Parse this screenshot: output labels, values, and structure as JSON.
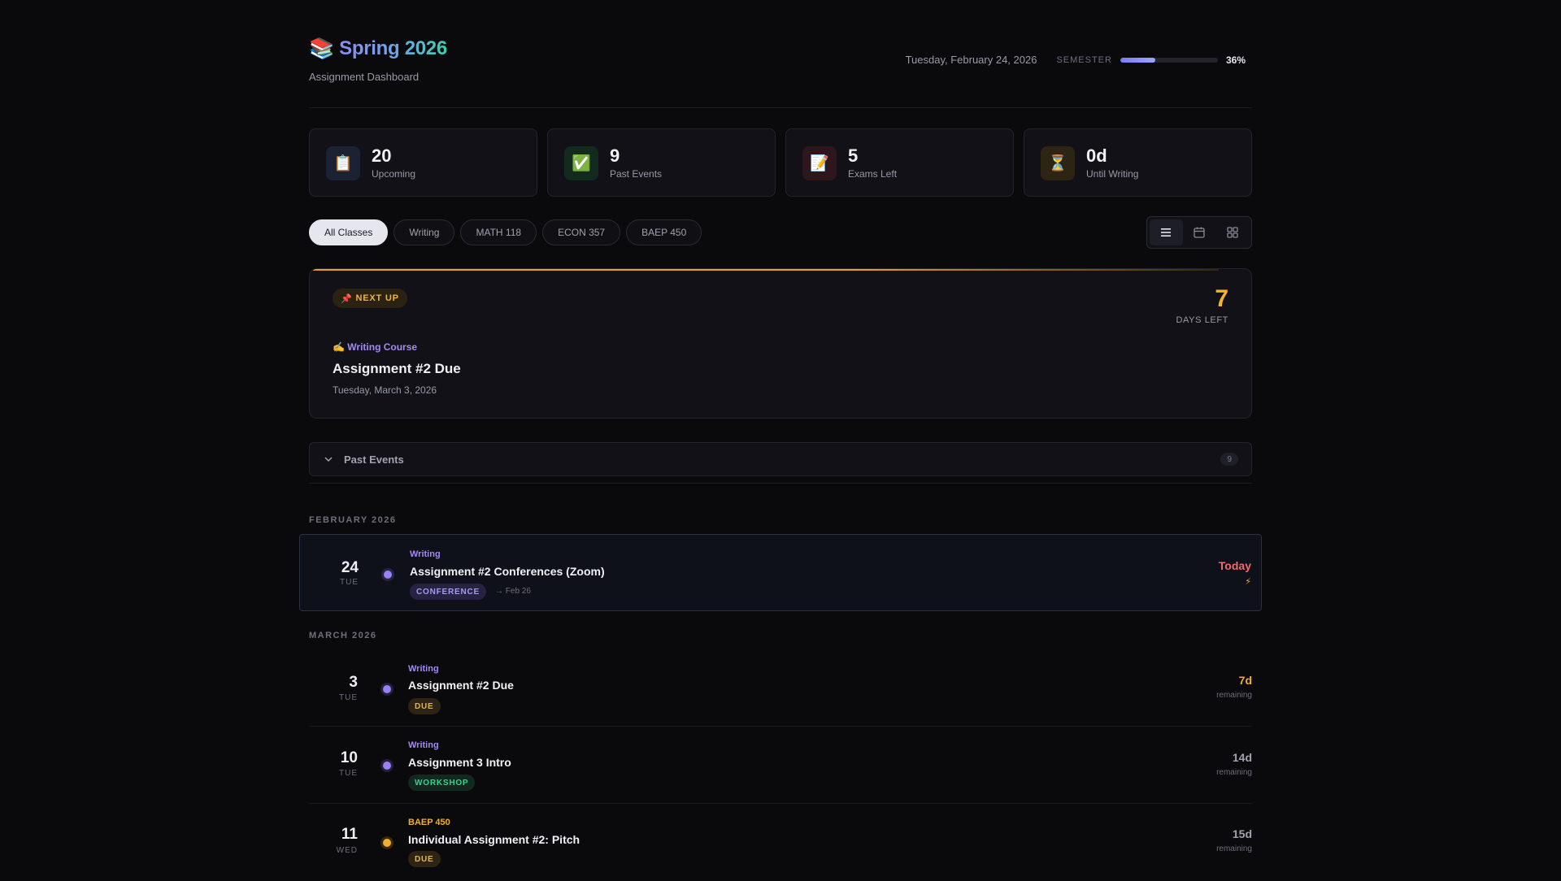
{
  "header": {
    "emoji": "📚",
    "title": "Spring 2026",
    "subtitle": "Assignment Dashboard",
    "today": "Tuesday, February 24, 2026",
    "semester_label": "SEMESTER",
    "semester_progress": 0.36,
    "semester_pct_text": "36%"
  },
  "stats": [
    {
      "icon": "📋",
      "value": "20",
      "label": "Upcoming"
    },
    {
      "icon": "✅",
      "value": "9",
      "label": "Past Events"
    },
    {
      "icon": "📝",
      "value": "5",
      "label": "Exams Left"
    },
    {
      "icon": "⏳",
      "value": "0d",
      "label": "Until Writing"
    }
  ],
  "filters": [
    "All Classes",
    "Writing",
    "MATH 118",
    "ECON 357",
    "BAEP 450"
  ],
  "active_filter": "All Classes",
  "views": [
    "list-view-icon",
    "calendar-view-icon",
    "grid-view-icon"
  ],
  "next_up": {
    "badge_icon": "📌",
    "badge": "NEXT UP",
    "days": "7",
    "days_label": "DAYS LEFT",
    "course_icon": "✍️",
    "course": "Writing Course",
    "title": "Assignment #2 Due",
    "date": "Tuesday, March 3, 2026"
  },
  "past_events": {
    "label": "Past Events",
    "count": "9"
  },
  "months": {
    "feb": "FEBRUARY 2026",
    "mar": "MARCH 2026"
  },
  "events": [
    {
      "day": "24",
      "dow": "TUE",
      "class": "Writing",
      "title": "Assignment #2 Conferences (Zoom)",
      "tag": "CONFERENCE",
      "note": "→ Feb 26",
      "remaining": "Today",
      "remaining_label": "⚡"
    },
    {
      "day": "3",
      "dow": "TUE",
      "class": "Writing",
      "title": "Assignment #2 Due",
      "tag": "DUE",
      "remaining": "7d",
      "remaining_label": "remaining"
    },
    {
      "day": "10",
      "dow": "TUE",
      "class": "Writing",
      "title": "Assignment 3 Intro",
      "tag": "WORKSHOP",
      "remaining": "14d",
      "remaining_label": "remaining"
    },
    {
      "day": "11",
      "dow": "WED",
      "class": "BAEP 450",
      "title": "Individual Assignment #2: Pitch",
      "tag": "DUE",
      "remaining": "15d",
      "remaining_label": "remaining"
    }
  ],
  "colors": {
    "accent_purple": "#a48af5",
    "accent_amber": "#f0b02a",
    "today_red": "#f26b6b",
    "background": "#0a0a0d"
  }
}
